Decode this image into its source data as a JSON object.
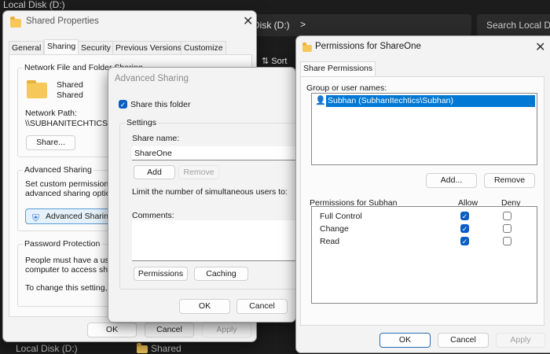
{
  "explorer": {
    "top_left_crumb": "Local Disk (D:)",
    "address_crumb": "Disk (D:)",
    "address_chevron": ">",
    "search_placeholder": "Search Local D",
    "sort_label": "Sort",
    "nav_item": "Local Disk (D:)",
    "file_item": "Shared"
  },
  "shared_properties": {
    "title": "Shared Properties",
    "tabs": [
      {
        "label": "General",
        "selected": false
      },
      {
        "label": "Sharing",
        "selected": true
      },
      {
        "label": "Security",
        "selected": false
      },
      {
        "label": "Previous Versions",
        "selected": false
      },
      {
        "label": "Customize",
        "selected": false
      }
    ],
    "network_group": {
      "label": "Network File and Folder Sharing",
      "name_line1": "Shared",
      "name_line2": "Shared",
      "path_label": "Network Path:",
      "path_value": "\\\\SUBHANITECHTICS\\S",
      "share_button": "Share..."
    },
    "advanced_group": {
      "label": "Advanced Sharing",
      "line1": "Set custom permissions, c",
      "line2": "advanced sharing options",
      "button": "Advanced Sharing"
    },
    "password_group": {
      "label": "Password Protection",
      "line1": "People must have a user",
      "line2": "computer to access share",
      "line3": "To change this setting, us"
    },
    "ok": "OK",
    "cancel": "Cancel",
    "apply": "Apply"
  },
  "advanced_sharing": {
    "title": "Advanced Sharing",
    "share_checkbox_label": "Share this folder",
    "share_checked": true,
    "settings_label": "Settings",
    "share_name_label": "Share name:",
    "share_name_value": "ShareOne",
    "add": "Add",
    "remove": "Remove",
    "limit_label": "Limit the number of simultaneous users to:",
    "comments_label": "Comments:",
    "comments_value": "",
    "permissions": "Permissions",
    "caching": "Caching",
    "ok": "OK",
    "cancel": "Cancel"
  },
  "permissions_dialog": {
    "title": "Permissions for ShareOne",
    "tab": "Share Permissions",
    "group_label": "Group or user names:",
    "users": [
      "Subhan (SubhanItechtics\\Subhan)"
    ],
    "add": "Add...",
    "remove": "Remove",
    "perm_header": "Permissions for Subhan",
    "allow_header": "Allow",
    "deny_header": "Deny",
    "permissions": [
      {
        "name": "Full Control",
        "allow": true,
        "deny": false
      },
      {
        "name": "Change",
        "allow": true,
        "deny": false
      },
      {
        "name": "Read",
        "allow": true,
        "deny": false
      }
    ],
    "ok": "OK",
    "cancel": "Cancel",
    "apply": "Apply"
  },
  "colors": {
    "accent": "#0078d4",
    "checkbox": "#0a5ec1",
    "folder": "#f6c85a"
  }
}
